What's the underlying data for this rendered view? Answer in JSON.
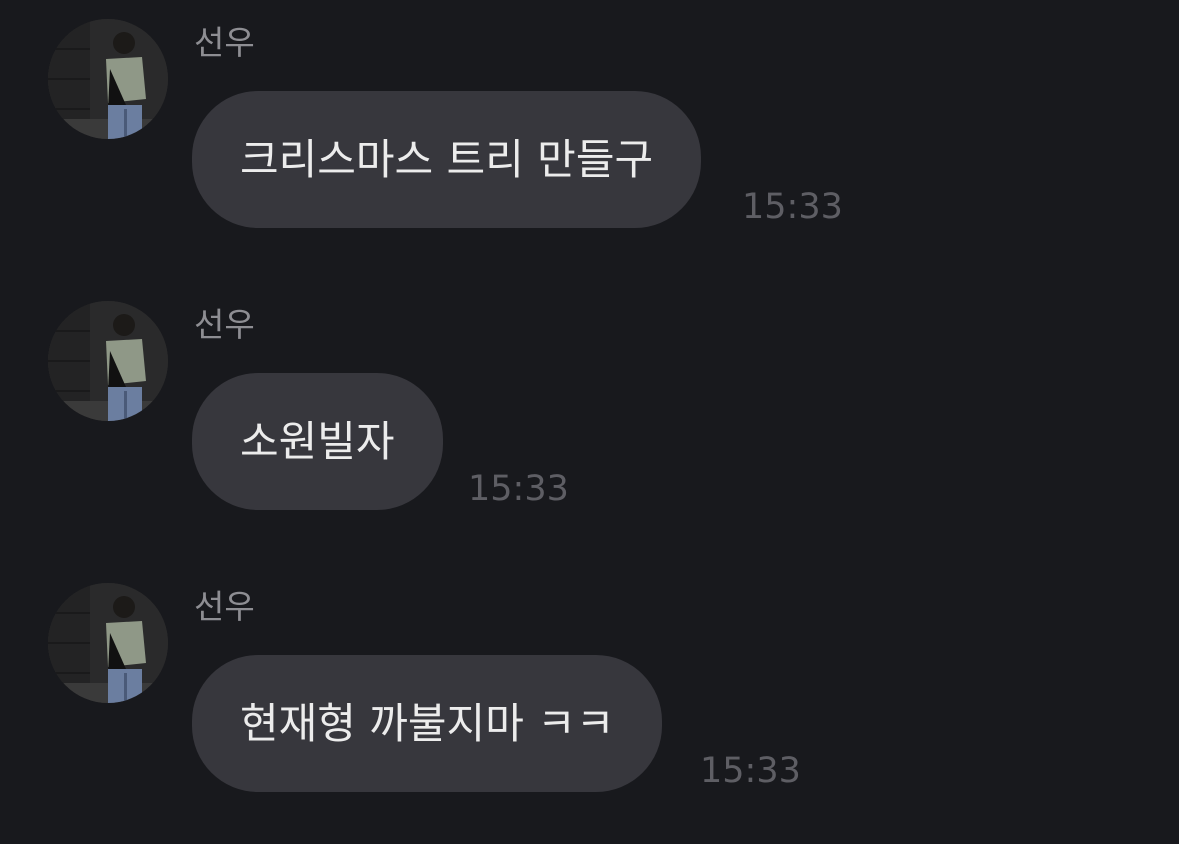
{
  "colors": {
    "background": "#18191d",
    "bubble": "#37373d",
    "bubble_text": "#ececec",
    "sender_name": "#8e8e93",
    "timestamp": "#5e5e64"
  },
  "messages": [
    {
      "sender": "선우",
      "avatar_icon": "profile-photo",
      "text": "크리스마스 트리 만들구",
      "time": "15:33"
    },
    {
      "sender": "선우",
      "avatar_icon": "profile-photo",
      "text": "소원빌자",
      "time": "15:33"
    },
    {
      "sender": "선우",
      "avatar_icon": "profile-photo",
      "text": "현재형 까불지마 ㅋㅋ",
      "time": "15:33"
    }
  ]
}
